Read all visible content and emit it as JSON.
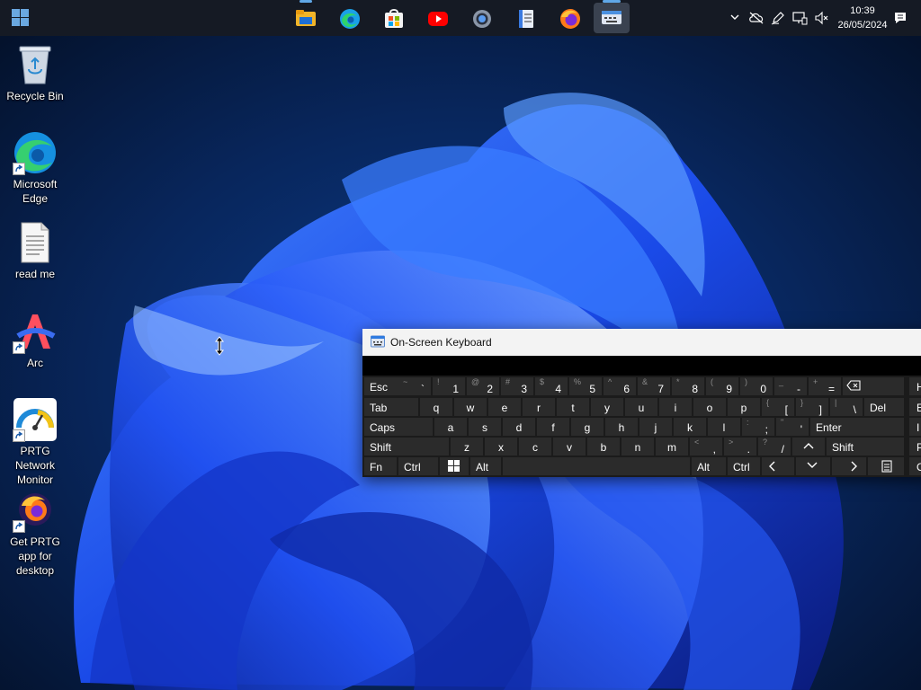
{
  "taskbar": {
    "apps": [
      {
        "name": "file-explorer-icon",
        "active": false
      },
      {
        "name": "edge-icon",
        "active": false
      },
      {
        "name": "store-icon",
        "active": false
      },
      {
        "name": "youtube-icon",
        "active": false
      },
      {
        "name": "settings-icon",
        "active": false
      },
      {
        "name": "notepad-icon",
        "active": false
      },
      {
        "name": "firefox-icon",
        "active": false
      },
      {
        "name": "keyboard-icon",
        "active": true
      }
    ],
    "tray_icons": [
      "chevron-up-icon",
      "cloud-off-icon",
      "pen-icon",
      "display-icon",
      "mute-icon"
    ],
    "time": "10:39",
    "date": "26/05/2024"
  },
  "desktop": {
    "icons": [
      {
        "label": "Recycle Bin",
        "icon": "recycle-bin-icon"
      },
      {
        "label": "Microsoft Edge",
        "icon": "edge-icon"
      },
      {
        "label": "read me",
        "icon": "text-file-icon"
      },
      {
        "label": "Arc",
        "icon": "arc-icon"
      },
      {
        "label": "PRTG Network Monitor",
        "icon": "prtg-icon"
      },
      {
        "label": "Get PRTG app for desktop",
        "icon": "prtg-firefox-icon"
      }
    ]
  },
  "osk": {
    "title": "On-Screen Keyboard",
    "rows": [
      [
        "Esc",
        "~ `",
        "! 1",
        "@ 2",
        "# 3",
        "$ 4",
        "% 5",
        "^ 6",
        "& 7",
        "* 8",
        "( 9",
        ") 0",
        "_ -",
        "+ =",
        "backspace"
      ],
      [
        "Tab",
        "q",
        "w",
        "e",
        "r",
        "t",
        "y",
        "u",
        "i",
        "o",
        "p",
        "{ [",
        "} ]",
        "| \\",
        "Del"
      ],
      [
        "Caps",
        "a",
        "s",
        "d",
        "f",
        "g",
        "h",
        "j",
        "k",
        "l",
        ": ;",
        "\" '",
        "Enter"
      ],
      [
        "Shift",
        "z",
        "x",
        "c",
        "v",
        "b",
        "n",
        "m",
        "< ,",
        "> .",
        "? /",
        "up",
        "Shift"
      ],
      [
        "Fn",
        "Ctrl",
        "win",
        "Alt",
        "space",
        "Alt",
        "Ctrl",
        "left",
        "down",
        "right",
        "menu"
      ]
    ],
    "side_keys": [
      "H",
      "E",
      "I",
      "P",
      "O"
    ]
  },
  "colors": {
    "taskbar": "#151a24",
    "accent": "#60a8e8",
    "key_bg": "#2b2b2b",
    "osk_bg": "#1b1b1b"
  }
}
